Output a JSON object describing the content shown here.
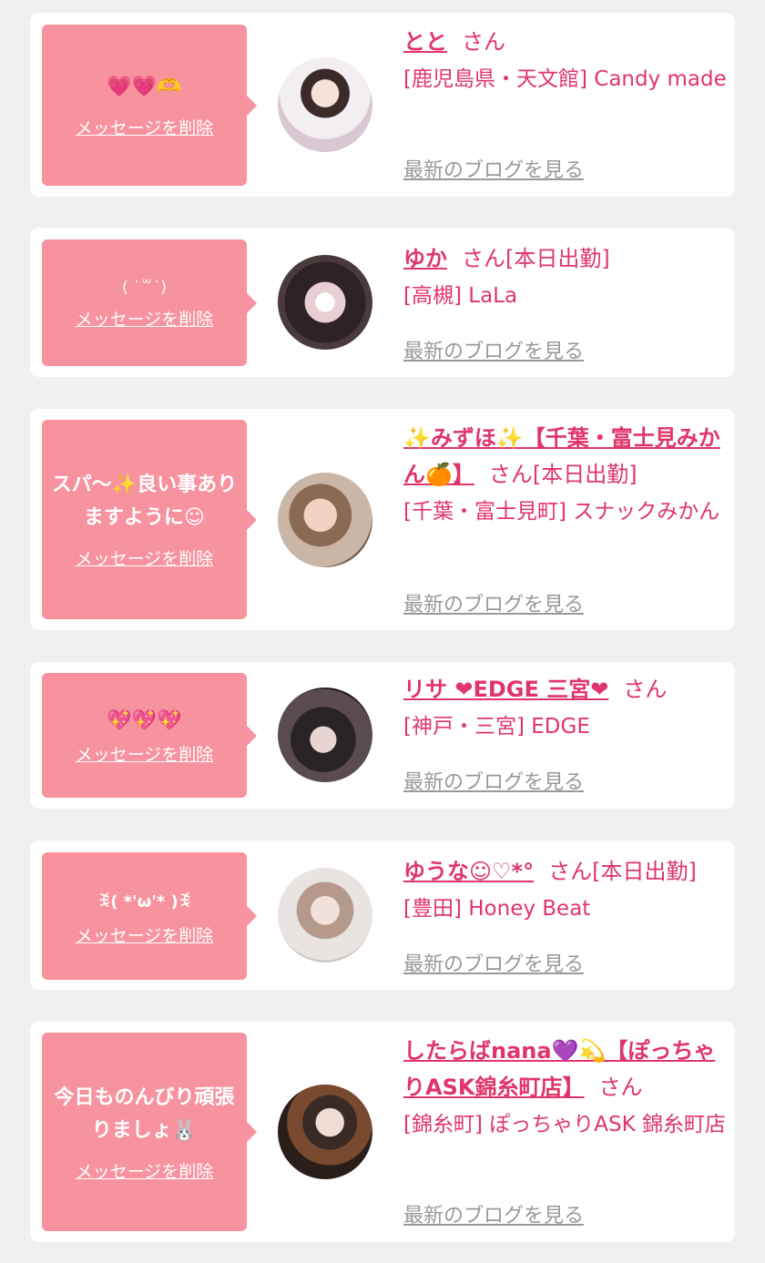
{
  "favorites": [
    {
      "message": "💗💗🫶",
      "delete_label": "メッセージを削除",
      "name": "とと",
      "honorific": "さん",
      "status": "",
      "shop": "[鹿児島県・天文館] Candy made",
      "blog_label": "最新のブログを見る"
    },
    {
      "message": "( ˙꒳˙)",
      "delete_label": "メッセージを削除",
      "name": "ゆか",
      "honorific": "さん",
      "status": "[本日出勤]",
      "shop": "[高槻] LaLa",
      "blog_label": "最新のブログを見る"
    },
    {
      "message": "スパ〜✨良い事ありますように☺︎",
      "delete_label": "メッセージを削除",
      "name": "✨みずほ✨【千葉・富士見みかん🍊】",
      "honorific": "さん",
      "status": "[本日出勤]",
      "shop": "[千葉・富士見町] スナックみかん",
      "blog_label": "最新のブログを見る"
    },
    {
      "message": "💖💖💖",
      "delete_label": "メッセージを削除",
      "name": "リサ ❤EDGE 三宮❤",
      "honorific": "さん",
      "status": "",
      "shop": "[神戸・三宮] EDGE",
      "blog_label": "最新のブログを見る"
    },
    {
      "message": "ꉂ( *'ω'* )ꉂ",
      "delete_label": "メッセージを削除",
      "name": "ゆうな☺︎♡*°",
      "honorific": "さん",
      "status": "[本日出勤]",
      "shop": "[豊田] Honey Beat",
      "blog_label": "最新のブログを見る"
    },
    {
      "message": "今日ものんびり頑張りましょ🐰",
      "delete_label": "メッセージを削除",
      "name": "したらばnana💜💫【ぽっちゃりASK錦糸町店】",
      "honorific": "さん",
      "status": "",
      "shop": "[錦糸町] ぽっちゃりASK 錦糸町店",
      "blog_label": "最新のブログを見る"
    }
  ],
  "colors": {
    "bubble": "#f7929f",
    "accent": "#e0356a",
    "link_gray": "#999999",
    "card": "#ffffff",
    "background": "#f0f0f0"
  }
}
